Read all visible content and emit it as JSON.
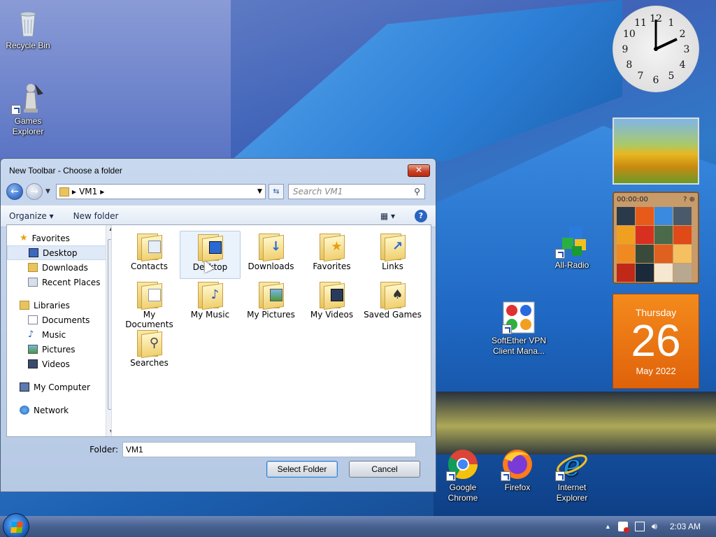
{
  "desktop_icons": [
    {
      "label": "Recycle Bin",
      "icon": "recycle-bin-icon"
    },
    {
      "label": "Games Explorer",
      "icon": "games-explorer-icon"
    },
    {
      "label": "All-Radio",
      "icon": "all-radio-icon"
    },
    {
      "label": "SoftEther VPN Client Mana...",
      "icon": "softether-vpn-icon"
    },
    {
      "label": "Google Chrome",
      "icon": "chrome-icon"
    },
    {
      "label": "Firefox",
      "icon": "firefox-icon"
    },
    {
      "label": "Internet Explorer",
      "icon": "internet-explorer-icon"
    }
  ],
  "gadgets": {
    "clock": {
      "numerals": [
        "12",
        "1",
        "2",
        "3",
        "4",
        "5",
        "6",
        "7",
        "8",
        "9",
        "10",
        "11"
      ]
    },
    "puzzle": {
      "timer": "00:00:00"
    },
    "calendar": {
      "day_name": "Thursday",
      "day_number": "26",
      "month_year": "May 2022"
    }
  },
  "dialog": {
    "title": "New Toolbar - Choose a folder",
    "close_label": "✕",
    "address": "VM1",
    "search_placeholder": "Search VM1",
    "toolbar": {
      "organize": "Organize ▾",
      "new_folder": "New folder"
    },
    "nav": {
      "favorites": "Favorites",
      "favorites_items": [
        "Desktop",
        "Downloads",
        "Recent Places"
      ],
      "libraries": "Libraries",
      "libraries_items": [
        "Documents",
        "Music",
        "Pictures",
        "Videos"
      ],
      "my_computer": "My Computer",
      "network": "Network"
    },
    "folders": [
      "Contacts",
      "Desktop",
      "Downloads",
      "Favorites",
      "Links",
      "My Documents",
      "My Music",
      "My Pictures",
      "My Videos",
      "Saved Games",
      "Searches"
    ],
    "folder_label": "Folder:",
    "folder_value": "VM1",
    "select_button": "Select Folder",
    "cancel_button": "Cancel"
  },
  "taskbar": {
    "time": "2:03 AM"
  },
  "colors": {
    "accent": "#2a63c0",
    "calendar": "#e8700f",
    "close": "#c8432a"
  }
}
